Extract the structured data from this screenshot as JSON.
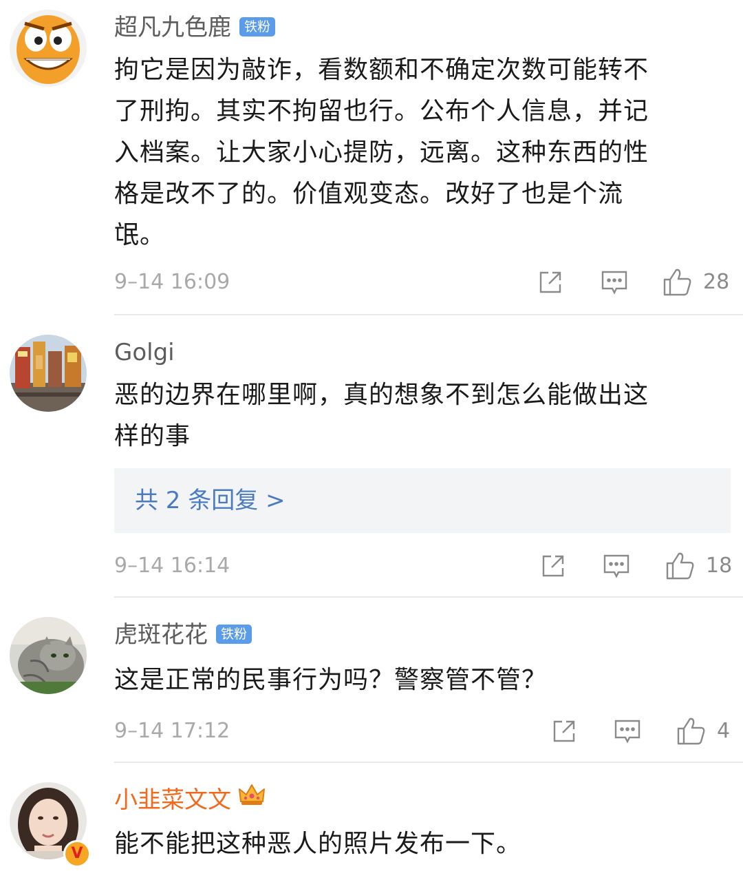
{
  "comments": [
    {
      "username": "超凡九色鹿",
      "badge": "铁粉",
      "lines": [
        "拘它是因为敲诈，看数额和不确定次数可能转不",
        "了刑拘。其实不拘留也行。公布个人信息，并记",
        "入档案。让大家小心提防，远离。这种东西的性",
        "格是改不了的。价值观变态。改好了也是个流",
        "氓。"
      ],
      "time": "9–14 16:09",
      "likes": "28"
    },
    {
      "username": "Golgi",
      "lines": [
        "恶的边界在哪里啊，真的想象不到怎么能做出这",
        "样的事"
      ],
      "replies_label": "共 2 条回复 >",
      "time": "9–14 16:14",
      "likes": "18"
    },
    {
      "username": "虎斑花花",
      "badge": "铁粉",
      "lines": [
        "这是正常的民事行为吗？警察管不管？"
      ],
      "time": "9–14 17:12",
      "likes": "4"
    },
    {
      "username": "小韭菜文文",
      "lines": [
        "能不能把这种恶人的照片发布一下。"
      ],
      "verified_label": "V"
    }
  ],
  "icons": {
    "share": "share-icon",
    "comment": "comment-icon",
    "like": "thumbs-up-icon",
    "crown": "crown-icon"
  },
  "colors": {
    "badge": "#5a9bea",
    "vip_name": "#f06a1e",
    "reply_link": "#4a7bc0"
  }
}
